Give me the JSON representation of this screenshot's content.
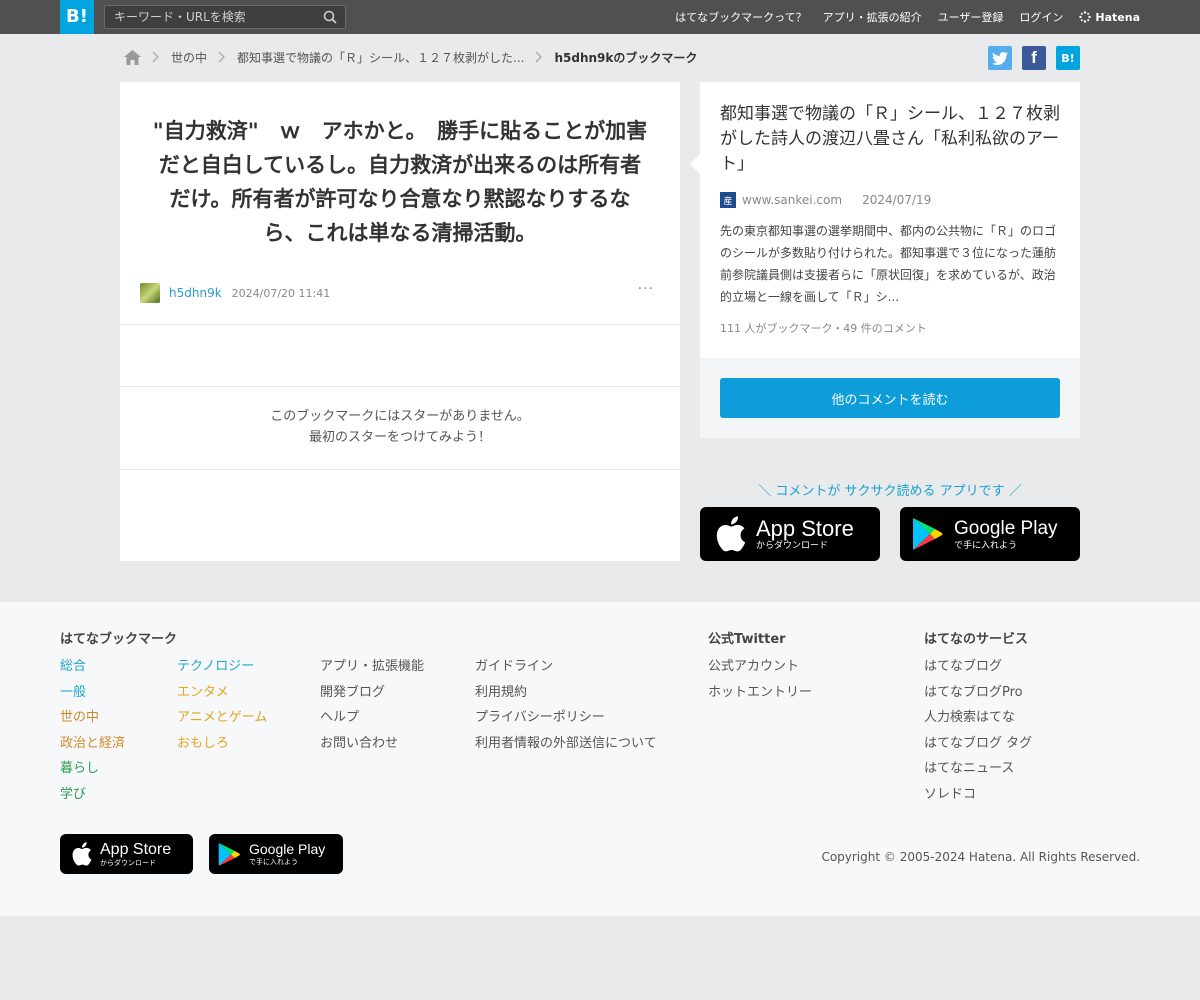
{
  "header": {
    "logo": "B!",
    "search_placeholder": "キーワード・URLを検索",
    "nav": [
      "はてなブックマークって？",
      "アプリ・拡張の紹介",
      "ユーザー登録",
      "ログイン"
    ],
    "brand": "Hatena"
  },
  "breadcrumb": {
    "items": [
      "世の中",
      "都知事選で物議の「Ｒ」シール、１２７枚剥がした...",
      "h5dhn9kのブックマーク"
    ]
  },
  "share": {
    "facebook": "f",
    "hatena": "B!"
  },
  "bookmark": {
    "comment": "\"自力救済\"　ｗ　アホかと。　勝手に貼ることが加害だと自白しているし。自力救済が出来るのは所有者だけ。所有者が許可なり合意なり黙認なりするなら、これは単なる清掃活動。",
    "user": "h5dhn9k",
    "time": "2024/07/20 11:41",
    "more": "···",
    "nostar_line1": "このブックマークにはスターがありません。",
    "nostar_line2": "最初のスターをつけてみよう！"
  },
  "entry": {
    "title": "都知事選で物議の「Ｒ」シール、１２７枚剥がした詩人の渡辺八畳さん「私利私欲のアート」",
    "favicon": "産",
    "domain": "www.sankei.com",
    "date": "2024/07/19",
    "summary": "先の東京都知事選の選挙期間中、都内の公共物に「Ｒ」のロゴのシールが多数貼り付けられた。都知事選で３位になった蓮舫前参院議員側は支援者らに「原状回復」を求めているが、政治的立場と一線を画して「Ｒ」シ...",
    "stats": "111 人がブックマーク・49 件のコメント",
    "read_button": "他のコメントを読む"
  },
  "promo": {
    "text": "＼ コメントが サクサク読める アプリです ／",
    "appstore_big": "App Store",
    "appstore_small": "からダウンロード",
    "googleplay_big": "Google Play",
    "googleplay_small": "で手に入れよう"
  },
  "footer": {
    "col1_title": "はてなブックマーク",
    "col1a": [
      "総合",
      "一般",
      "世の中",
      "政治と経済",
      "暮らし",
      "学び"
    ],
    "col1b": [
      "テクノロジー",
      "エンタメ",
      "アニメとゲーム",
      "おもしろ"
    ],
    "col2": [
      "アプリ・拡張機能",
      "開発ブログ",
      "ヘルプ",
      "お問い合わせ"
    ],
    "col3": [
      "ガイドライン",
      "利用規約",
      "プライバシーポリシー",
      "利用者情報の外部送信について"
    ],
    "twitter_title": "公式Twitter",
    "twitter": [
      "公式アカウント",
      "ホットエントリー"
    ],
    "services_title": "はてなのサービス",
    "services": [
      "はてなブログ",
      "はてなブログPro",
      "人力検索はてな",
      "はてなブログ タグ",
      "はてなニュース",
      "ソレドコ"
    ],
    "copyright": "Copyright © 2005-2024 Hatena. All Rights Reserved."
  },
  "colors": {
    "brand_blue": "#00a4de",
    "link_blue": "#2e9acf",
    "cat_general": "#21a5c9",
    "cat_society": "#d08a2b",
    "cat_life": "#2b9a52",
    "cat_tech": "#21a5c9",
    "cat_ent": "#e6a21b"
  }
}
